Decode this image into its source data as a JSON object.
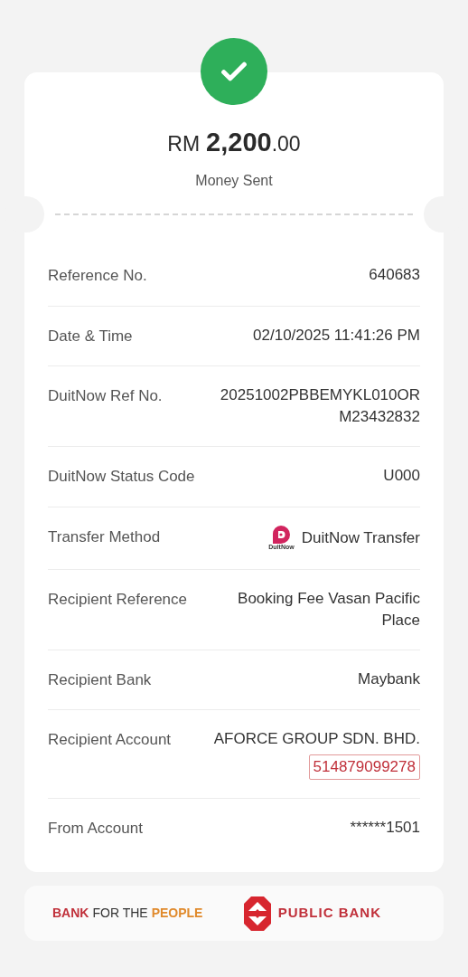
{
  "header": {
    "currency": "RM",
    "amount": "2,200",
    "cents": ".00",
    "status": "Money Sent"
  },
  "rows": [
    {
      "kind": "text",
      "label": "Reference No.",
      "value": "640683"
    },
    {
      "kind": "text",
      "label": "Date & Time",
      "value": "02/10/2025 11:41:26 PM"
    },
    {
      "kind": "text",
      "label": "DuitNow Ref No.",
      "value": "20251002PBBEMYKL010OR M23432832"
    },
    {
      "kind": "text",
      "label": "DuitNow Status Code",
      "value": "U000"
    },
    {
      "kind": "method",
      "label": "Transfer Method",
      "logo_text": "DuitNow",
      "value": "DuitNow Transfer"
    },
    {
      "kind": "text",
      "label": "Recipient Reference",
      "value": "Booking Fee Vasan Pacific Place"
    },
    {
      "kind": "text",
      "label": "Recipient Bank",
      "value": "Maybank"
    },
    {
      "kind": "account",
      "label": "Recipient Account",
      "value": "AFORCE GROUP SDN. BHD.",
      "account_number": "514879099278"
    },
    {
      "kind": "text",
      "label": "From Account",
      "value": "******1501"
    }
  ],
  "footer": {
    "slogan": [
      {
        "text": "BANK",
        "color": "#c0303a"
      },
      {
        "text": "FOR THE",
        "color": "#333333"
      },
      {
        "text": "PEOPLE",
        "color": "#e08a2c"
      }
    ],
    "bank_name": "PUBLIC BANK"
  }
}
